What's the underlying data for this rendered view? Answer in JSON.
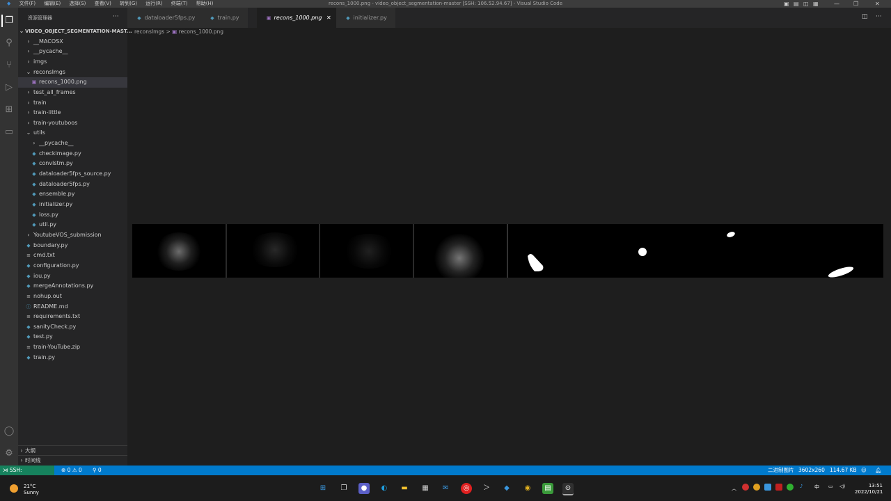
{
  "titlebar": {
    "menu": [
      "文件(F)",
      "编辑(E)",
      "选择(S)",
      "查看(V)",
      "转到(G)",
      "运行(R)",
      "终端(T)",
      "帮助(H)"
    ],
    "title": "recons_1000.png - video_object_segmentation-master [SSH: 106.52.94.67] - Visual Studio Code"
  },
  "sidebar": {
    "header": "资源管理器",
    "root": "VIDEO_OBJECT_SEGMENTATION-MAST...",
    "items": [
      {
        "label": "__MACOSX",
        "type": "folder",
        "expanded": false,
        "depth": 1
      },
      {
        "label": "__pycache__",
        "type": "folder",
        "expanded": false,
        "depth": 1
      },
      {
        "label": "imgs",
        "type": "folder",
        "expanded": false,
        "depth": 1
      },
      {
        "label": "reconsImgs",
        "type": "folder",
        "expanded": true,
        "depth": 1
      },
      {
        "label": "recons_1000.png",
        "type": "png",
        "depth": 2,
        "selected": true
      },
      {
        "label": "test_all_frames",
        "type": "folder",
        "expanded": false,
        "depth": 1
      },
      {
        "label": "train",
        "type": "folder",
        "expanded": false,
        "depth": 1
      },
      {
        "label": "train-little",
        "type": "folder",
        "expanded": false,
        "depth": 1
      },
      {
        "label": "train-youtuboos",
        "type": "folder",
        "expanded": false,
        "depth": 1
      },
      {
        "label": "utils",
        "type": "folder",
        "expanded": true,
        "depth": 1
      },
      {
        "label": "__pycache__",
        "type": "folder",
        "expanded": false,
        "depth": 2
      },
      {
        "label": "checkimage.py",
        "type": "py",
        "depth": 2
      },
      {
        "label": "convlstm.py",
        "type": "py",
        "depth": 2
      },
      {
        "label": "dataloader5fps_source.py",
        "type": "py",
        "depth": 2
      },
      {
        "label": "dataloader5fps.py",
        "type": "py",
        "depth": 2
      },
      {
        "label": "ensemble.py",
        "type": "py",
        "depth": 2
      },
      {
        "label": "initializer.py",
        "type": "py",
        "depth": 2
      },
      {
        "label": "loss.py",
        "type": "py",
        "depth": 2
      },
      {
        "label": "util.py",
        "type": "py",
        "depth": 2
      },
      {
        "label": "YoutubeVOS_submission",
        "type": "folder",
        "expanded": false,
        "depth": 1
      },
      {
        "label": "boundary.py",
        "type": "py",
        "depth": 1
      },
      {
        "label": "cmd.txt",
        "type": "txt",
        "depth": 1
      },
      {
        "label": "configuration.py",
        "type": "py",
        "depth": 1
      },
      {
        "label": "iou.py",
        "type": "py",
        "depth": 1
      },
      {
        "label": "mergeAnnotations.py",
        "type": "py",
        "depth": 1
      },
      {
        "label": "nohup.out",
        "type": "txt",
        "depth": 1
      },
      {
        "label": "README.md",
        "type": "info",
        "depth": 1
      },
      {
        "label": "requirements.txt",
        "type": "txt",
        "depth": 1
      },
      {
        "label": "sanityCheck.py",
        "type": "py",
        "depth": 1
      },
      {
        "label": "test.py",
        "type": "py",
        "depth": 1
      },
      {
        "label": "train-YouTube.zip",
        "type": "txt",
        "depth": 1
      },
      {
        "label": "train.py",
        "type": "py",
        "depth": 1
      }
    ],
    "outline": "大纲",
    "timeline": "时间线"
  },
  "tabs": [
    {
      "label": "dataloader5fps.py",
      "type": "py",
      "active": false
    },
    {
      "label": "train.py",
      "type": "py",
      "active": false
    },
    {
      "label": "recons_1000.png",
      "type": "png",
      "active": true
    },
    {
      "label": "initializer.py",
      "type": "py",
      "active": false
    }
  ],
  "breadcrumb": {
    "folder": "reconsImgs",
    "sep": ">",
    "file": "recons_1000.png"
  },
  "status": {
    "remote": "SSH: 106.52.94.67",
    "problems": "⊗ 0 ⚠ 0",
    "ports": "⚲ 0",
    "image_label": "二进制图片",
    "dimensions": "3602x260",
    "filesize": "114.67 KB"
  },
  "taskbar": {
    "weather_temp": "21°C",
    "weather_desc": "Sunny",
    "ime": "中",
    "time": "13:51",
    "date": "2022/10/21"
  },
  "colors": {
    "statusbar": "#007acc",
    "remote": "#16825d",
    "sidebar": "#252526",
    "editor": "#1e1e1e"
  }
}
